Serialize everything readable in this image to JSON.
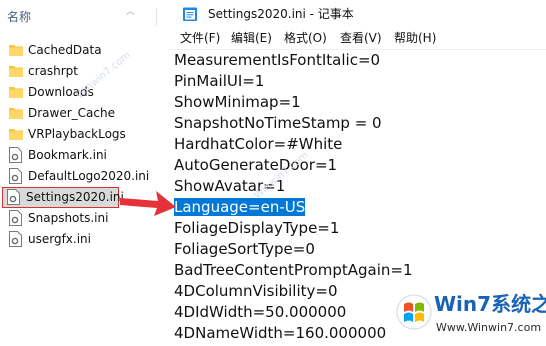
{
  "explorer": {
    "column_header": "名称",
    "items": [
      {
        "type": "folder",
        "name": "CachedData"
      },
      {
        "type": "folder",
        "name": "crashrpt"
      },
      {
        "type": "folder",
        "name": "Downloads"
      },
      {
        "type": "folder",
        "name": "Drawer_Cache"
      },
      {
        "type": "folder",
        "name": "VRPlaybackLogs"
      },
      {
        "type": "file",
        "name": "Bookmark.ini"
      },
      {
        "type": "file",
        "name": "DefaultLogo2020.ini"
      },
      {
        "type": "file",
        "name": "Settings2020.ini",
        "selected": true
      },
      {
        "type": "file",
        "name": "Snapshots.ini"
      },
      {
        "type": "file",
        "name": "usergfx.ini"
      }
    ]
  },
  "notepad": {
    "title": "Settings2020.ini - 记事本",
    "menu": [
      "文件(F)",
      "编辑(E)",
      "格式(O)",
      "查看(V)",
      "帮助(H)"
    ],
    "lines": [
      "MeasurementIsFontItalic=0",
      "PinMailUI=1",
      "ShowMinimap=1",
      "SnapshotNoTimeStamp = 0",
      "HardhatColor=#White",
      "AutoGenerateDoor=1",
      "ShowAvatar=1",
      "Language=en-US",
      "FoliageDisplayType=1",
      "FoliageSortType=0",
      "BadTreeContentPromptAgain=1",
      "4DColumnVisibility=0",
      "4DIdWidth=50.000000",
      "4DNameWidth=160.000000"
    ],
    "highlighted_line_index": 7
  },
  "watermark": {
    "brand_prefix": "Win7",
    "brand_suffix": "系统之家",
    "url": "Www.Winwin7.com",
    "faint_text": "Winwin7.com"
  },
  "colors": {
    "selection_blue": "#0078d7",
    "selection_outline_red": "#d53135",
    "arrow_red": "#e53238",
    "folder_yellow": "#f4c542"
  }
}
